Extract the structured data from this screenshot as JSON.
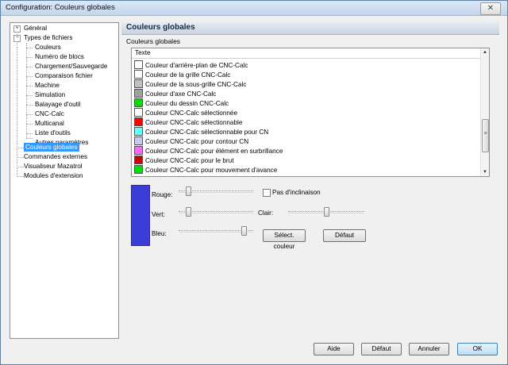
{
  "window": {
    "title": "Configuration: Couleurs globales",
    "close_glyph": "✕"
  },
  "tree": {
    "items": [
      {
        "label": "Général"
      },
      {
        "label": "Types de fichiers"
      },
      {
        "label": "Couleurs"
      },
      {
        "label": "Numéro de blocs"
      },
      {
        "label": "Chargement/Sauvegarde"
      },
      {
        "label": "Comparaison fichier"
      },
      {
        "label": "Machine"
      },
      {
        "label": "Simulation"
      },
      {
        "label": "Balayage d'outil"
      },
      {
        "label": "CNC-Calc"
      },
      {
        "label": "Multicanal"
      },
      {
        "label": "Liste d'outils"
      },
      {
        "label": "Autres paramètres"
      },
      {
        "label": "Couleurs globales"
      },
      {
        "label": "Commandes externes"
      },
      {
        "label": "Visualiseur Mazatrol"
      },
      {
        "label": "Modules d'extension"
      }
    ],
    "expander_plus": "+",
    "expander_minus": "−"
  },
  "header": {
    "title": "Couleurs globales"
  },
  "group": {
    "label": "Couleurs globales"
  },
  "list": {
    "column_header": "Texte",
    "rows": [
      {
        "label": "Couleur d'arrière-plan de CNC-Calc",
        "color": "#ffffff"
      },
      {
        "label": "Couleur de la grille CNC-Calc",
        "color": "#ffffff"
      },
      {
        "label": "Couleur de la sous-grille CNC-Calc",
        "color": "#c0c0c0"
      },
      {
        "label": "Couleur d'axe CNC-Calc",
        "color": "#a0a0a0"
      },
      {
        "label": "Couleur du dessin CNC-Calc",
        "color": "#00e000"
      },
      {
        "label": "Couleur CNC-Calc sélectionnée",
        "color": "#ffffff"
      },
      {
        "label": "Couleur CNC-Calc sélectionnable",
        "color": "#ff0000"
      },
      {
        "label": "Couleur CNC-Calc sélectionnable pour CN",
        "color": "#66ffff"
      },
      {
        "label": "Couleur CNC-Calc pour contour CN",
        "color": "#c8c8f0"
      },
      {
        "label": "Couleur CNC-Calc pour élément en surbrillance",
        "color": "#ff66ff"
      },
      {
        "label": "Couleur CNC-Calc pour le brut",
        "color": "#cc0000"
      },
      {
        "label": "Couleur CNC-Calc pour mouvement d'avance",
        "color": "#00e000"
      }
    ],
    "scroll_up": "▲",
    "scroll_down": "▼",
    "scroll_grip": "≡"
  },
  "editor": {
    "preview_color": "#3c3cd8",
    "red_label": "Rouge:",
    "green_label": "Vert:",
    "blue_label": "Bleu:",
    "red_level": 0.13,
    "green_level": 0.13,
    "blue_level": 0.87,
    "no_tilt_label": "Pas d'inclinaison",
    "no_tilt_checked": false,
    "brightness_label": "Clair:",
    "brightness_level": 0.5,
    "select_color_button": "Sélect. couleur",
    "default_button": "Défaut"
  },
  "footer": {
    "help": "Aide",
    "default": "Défaut",
    "cancel": "Annuler",
    "ok": "OK"
  }
}
